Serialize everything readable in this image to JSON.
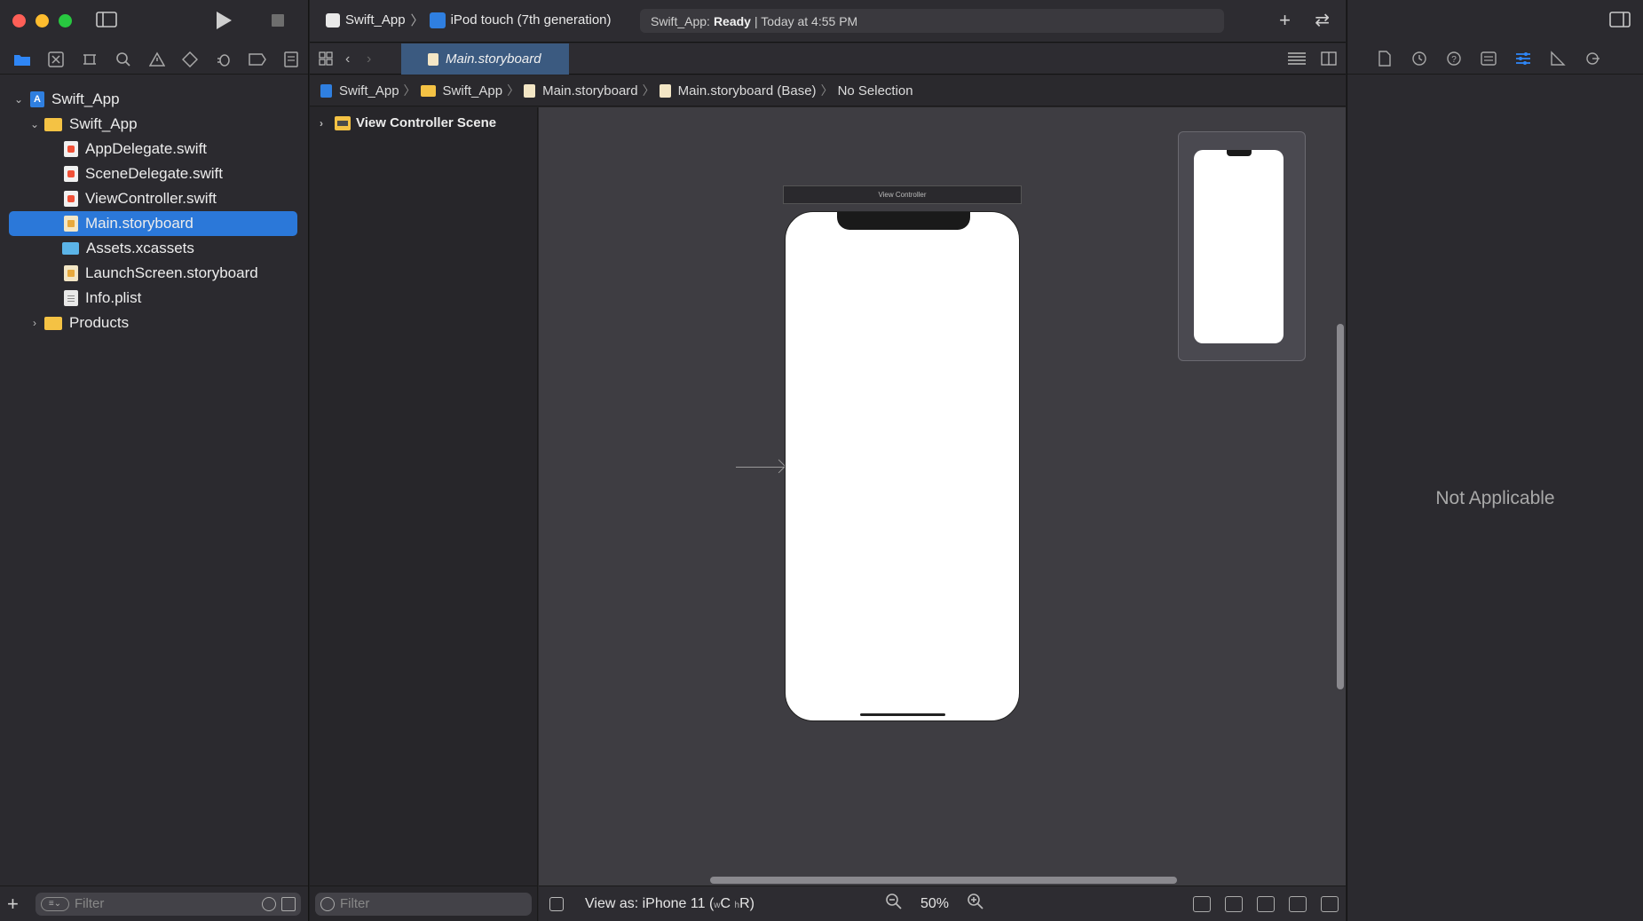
{
  "toolbar": {
    "scheme_app": "Swift_App",
    "scheme_device": "iPod touch (7th generation)",
    "status_prefix": "Swift_App:",
    "status_state": "Ready",
    "status_time": "| Today at 4:55 PM"
  },
  "navigator": {
    "tabs": [
      "folder-icon",
      "source-control-icon",
      "symbol-icon",
      "search-icon",
      "warning-icon",
      "test-icon",
      "debug-icon",
      "breakpoint-icon",
      "report-icon"
    ],
    "tree": [
      {
        "label": "Swift_App",
        "type": "project",
        "level": 0,
        "expanded": true
      },
      {
        "label": "Swift_App",
        "type": "folder",
        "level": 1,
        "expanded": true
      },
      {
        "label": "AppDelegate.swift",
        "type": "swift",
        "level": 2
      },
      {
        "label": "SceneDelegate.swift",
        "type": "swift",
        "level": 2
      },
      {
        "label": "ViewController.swift",
        "type": "swift",
        "level": 2
      },
      {
        "label": "Main.storyboard",
        "type": "storyboard",
        "level": 2,
        "selected": true
      },
      {
        "label": "Assets.xcassets",
        "type": "assets",
        "level": 2
      },
      {
        "label": "LaunchScreen.storyboard",
        "type": "storyboard",
        "level": 2
      },
      {
        "label": "Info.plist",
        "type": "plist",
        "level": 2
      },
      {
        "label": "Products",
        "type": "folder",
        "level": 1,
        "expanded": false
      }
    ],
    "filter_placeholder": "Filter"
  },
  "editor": {
    "tab_label": "Main.storyboard",
    "jumpbar": [
      "Swift_App",
      "Swift_App",
      "Main.storyboard",
      "Main.storyboard (Base)",
      "No Selection"
    ],
    "outline_scene": "View Controller Scene",
    "outline_filter_placeholder": "Filter",
    "vc_title": "View Controller",
    "view_as_prefix": "View as: iPhone 11 (",
    "view_as_w": "w",
    "view_as_c": "C",
    "view_as_h": "h",
    "view_as_r": "R)",
    "zoom_level": "50%"
  },
  "inspector": {
    "tabs": [
      "file-icon",
      "history-icon",
      "help-icon",
      "identity-icon",
      "attributes-icon",
      "size-icon",
      "connections-icon"
    ],
    "empty_text": "Not Applicable"
  }
}
